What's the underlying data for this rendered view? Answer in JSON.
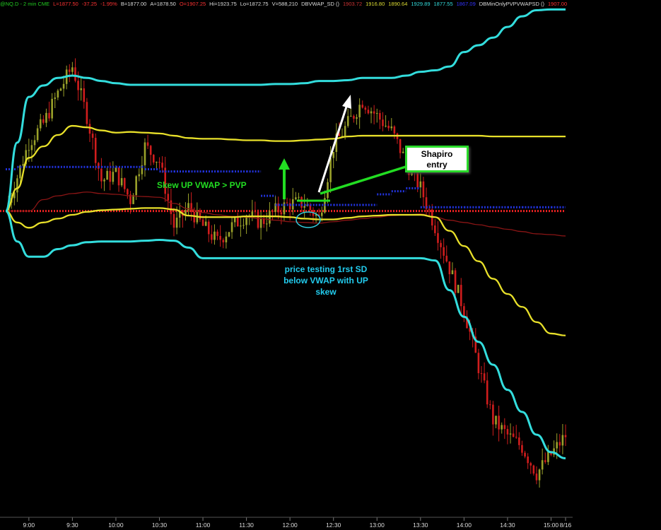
{
  "header": {
    "items": [
      {
        "text": "@NQ.D - 2 min  CME",
        "color": "#22cc22"
      },
      {
        "text": "L=1877.50",
        "color": "#ff3333"
      },
      {
        "text": "-37.25",
        "color": "#ff3333"
      },
      {
        "text": "-1.95%",
        "color": "#ff3333"
      },
      {
        "text": "B=1877.00",
        "color": "#dddddd"
      },
      {
        "text": "A=1878.50",
        "color": "#dddddd"
      },
      {
        "text": "O=1907.25",
        "color": "#ff3333"
      },
      {
        "text": "Hi=1923.75",
        "color": "#dddddd"
      },
      {
        "text": "Lo=1872.75",
        "color": "#dddddd"
      },
      {
        "text": "V=588,210",
        "color": "#dddddd"
      },
      {
        "text": "DBVWAP_SD ()",
        "color": "#dddddd"
      },
      {
        "text": "1903.72",
        "color": "#cc3333"
      },
      {
        "text": "1916.80",
        "color": "#dddd33"
      },
      {
        "text": "1890.64",
        "color": "#dddd33"
      },
      {
        "text": "1929.89",
        "color": "#33dddd"
      },
      {
        "text": "1877.55",
        "color": "#33dddd"
      },
      {
        "text": "1867.09",
        "color": "#3333ff"
      },
      {
        "text": "DBMinOnlyPVPVWAPSD ()",
        "color": "#dddddd"
      },
      {
        "text": "1907.00",
        "color": "#ff3333"
      }
    ]
  },
  "annotations": {
    "skew": "Skew UP VWAP > PVP",
    "test_line1": "price testing 1rst SD",
    "test_line2": "below VWAP with UP",
    "test_line3": "skew",
    "entry_line1": "Shapiro",
    "entry_line2": "entry"
  },
  "colors": {
    "up": "#9aa12a",
    "down": "#d01d1d",
    "vwap": "#8a1515",
    "sd1": "#e8e02a",
    "sd2": "#33dddd",
    "pvp": "#2233dd",
    "reference": "#ee2222"
  },
  "chart_data": {
    "type": "line",
    "xlabel": "",
    "ylabel": "",
    "x_ticks": [
      "9:00",
      "9:30",
      "10:00",
      "10:30",
      "11:00",
      "11:30",
      "12:00",
      "12:30",
      "13:00",
      "13:30",
      "14:00",
      "14:30",
      "15:00",
      "8/16"
    ],
    "ylim": [
      1866,
      1934
    ],
    "time": [
      "8:44",
      "8:52",
      "9:00",
      "9:10",
      "9:20",
      "9:30",
      "9:40",
      "9:50",
      "10:00",
      "10:10",
      "10:20",
      "10:30",
      "10:40",
      "10:50",
      "11:00",
      "11:10",
      "11:20",
      "11:30",
      "11:40",
      "11:50",
      "12:00",
      "12:10",
      "12:20",
      "12:30",
      "12:40",
      "12:50",
      "13:00",
      "13:10",
      "13:20",
      "13:30",
      "13:40",
      "13:50",
      "14:00",
      "14:10",
      "14:20",
      "14:30",
      "14:40",
      "14:50",
      "15:00",
      "15:10"
    ],
    "series": [
      {
        "name": "VWAP",
        "values": [
          1907.0,
          1907.0,
          1907.0,
          1908.5,
          1909.0,
          1909.3,
          1909.5,
          1909.3,
          1909.2,
          1909.0,
          1908.9,
          1908.8,
          1908.0,
          1907.3,
          1906.8,
          1906.5,
          1906.3,
          1906.2,
          1906.0,
          1905.8,
          1905.6,
          1905.5,
          1905.4,
          1905.6,
          1905.8,
          1906.0,
          1906.2,
          1906.4,
          1906.5,
          1906.6,
          1906.2,
          1905.8,
          1905.5,
          1905.2,
          1904.9,
          1904.6,
          1904.3,
          1904.0,
          1903.9,
          1903.72
        ]
      },
      {
        "name": "",
        "values": [
          1907.0,
          1910.0,
          1914.0,
          1915.5,
          1917.0,
          1918.2,
          1918.0,
          1917.6,
          1917.3,
          1917.4,
          1917.3,
          1917.2,
          1916.9,
          1916.6,
          1916.5,
          1916.5,
          1916.4,
          1916.3,
          1916.3,
          1916.2,
          1916.2,
          1916.3,
          1916.4,
          1916.5,
          1916.8,
          1916.9,
          1916.9,
          1916.9,
          1916.9,
          1916.9,
          1916.9,
          1916.9,
          1916.9,
          1916.9,
          1916.8,
          1916.8,
          1916.8,
          1916.8,
          1916.8,
          1916.8
        ]
      },
      {
        "name": "",
        "values": [
          1907.0,
          1905.5,
          1904.8,
          1905.5,
          1906.0,
          1906.5,
          1906.9,
          1907.1,
          1907.2,
          1907.3,
          1907.4,
          1907.4,
          1907.2,
          1906.4,
          1906.2,
          1906.2,
          1906.2,
          1906.3,
          1906.3,
          1906.3,
          1906.2,
          1906.0,
          1905.9,
          1905.9,
          1906.1,
          1906.3,
          1906.4,
          1906.5,
          1906.5,
          1906.5,
          1906.2,
          1904.4,
          1902.4,
          1900.4,
          1898.1,
          1896.1,
          1894.4,
          1892.4,
          1890.9,
          1890.64
        ]
      },
      {
        "name": "",
        "values": [
          1907.0,
          1916.0,
          1922.0,
          1923.5,
          1924.5,
          1924.8,
          1924.5,
          1924.1,
          1923.8,
          1923.6,
          1923.6,
          1923.6,
          1923.6,
          1923.6,
          1923.6,
          1923.6,
          1923.6,
          1923.6,
          1923.6,
          1923.7,
          1923.7,
          1923.8,
          1924.1,
          1924.1,
          1924.2,
          1924.5,
          1924.5,
          1924.5,
          1924.8,
          1925.3,
          1925.5,
          1926.0,
          1927.9,
          1928.8,
          1929.8,
          1931.2,
          1932.6,
          1933.4,
          1933.5,
          1933.5
        ]
      },
      {
        "name": "",
        "values": [
          1907.0,
          1903.0,
          1901.0,
          1901.0,
          1902.0,
          1902.5,
          1902.9,
          1903.0,
          1903.0,
          1903.0,
          1903.1,
          1903.2,
          1903.1,
          1902.2,
          1900.8,
          1900.8,
          1900.8,
          1900.8,
          1900.8,
          1900.8,
          1900.8,
          1900.8,
          1900.8,
          1900.8,
          1900.8,
          1900.8,
          1900.8,
          1900.8,
          1900.8,
          1900.8,
          1900.5,
          1896.6,
          1893.1,
          1889.8,
          1886.8,
          1883.5,
          1880.6,
          1877.6,
          1875.3,
          1874.5
        ]
      },
      {
        "name": "",
        "values": [
          1907.0,
          1912.5,
          1912.8,
          1912.8,
          1912.8,
          1912.8,
          1912.8,
          1912.8,
          1912.8,
          1912.8,
          1912.8,
          1912.5,
          1912.2,
          1912.2,
          1912.2,
          1912.2,
          1912.2,
          1912.2,
          1912.2,
          1909.0,
          1907.8,
          1907.8,
          1907.8,
          1907.8,
          1907.8,
          1907.8,
          1907.8,
          1909.2,
          1909.6,
          1910.0,
          1907.5,
          1907.5,
          1907.5,
          1907.5,
          1907.5,
          1907.5,
          1907.5,
          1907.5,
          1907.5,
          1907.5
        ]
      },
      {
        "name": "",
        "values": [
          1907.0,
          1907.0,
          1907.0,
          1907.0,
          1907.0,
          1907.0,
          1907.0,
          1907.0,
          1907.0,
          1907.0,
          1907.0,
          1907.0,
          1907.0,
          1907.0,
          1907.0,
          1907.0,
          1907.0,
          1907.0,
          1907.0,
          1907.0,
          1907.0,
          1907.0,
          1907.0,
          1907.0,
          1907.0,
          1907.0,
          1907.0,
          1907.0,
          1907.0,
          1907.0,
          1907.0,
          1907.0,
          1907.0,
          1907.0,
          1907.0,
          1907.0,
          1907.0,
          1907.0,
          1907.0,
          1907.0
        ]
      },
      {
        "name": "Close",
        "values": [
          1907.0,
          1911.5,
          1916.0,
          1918.5,
          1922.5,
          1926.0,
          1919.5,
          1911.0,
          1912.0,
          1908.5,
          1915.5,
          1913.5,
          1905.0,
          1907.5,
          1905.0,
          1903.0,
          1905.0,
          1906.5,
          1905.5,
          1907.0,
          1908.0,
          1908.0,
          1906.0,
          1915.5,
          1918.5,
          1921.5,
          1919.5,
          1917.5,
          1913.5,
          1910.0,
          1905.0,
          1899.5,
          1894.0,
          1886.5,
          1879.5,
          1877.5,
          1876.0,
          1872.5,
          1875.0,
          1877.5
        ]
      }
    ]
  }
}
